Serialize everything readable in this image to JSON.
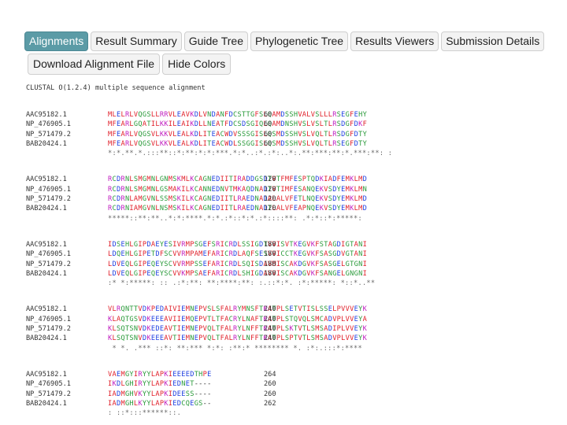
{
  "tabs": [
    "Alignments",
    "Result Summary",
    "Guide Tree",
    "Phylogenetic Tree",
    "Results Viewers",
    "Submission Details"
  ],
  "active_tab": "Alignments",
  "buttons": {
    "download": "Download Alignment File",
    "hide_colors": "Hide Colors"
  },
  "alignment": {
    "header": "CLUSTAL O(1.2.4) multiple sequence alignment",
    "blocks": [
      {
        "rows": [
          {
            "name": "AAC95182.1",
            "seq": "MLELRLVQGSLLRRVLEAVKDLVNDANFDCSTTGFSLQAMDSSHVALVSLLLRSEGFEHY",
            "pos": "60"
          },
          {
            "name": "NP_476905.1",
            "seq": "MFEARLGQATILKKILEAIKDLLNEATFDCSDSGIQLQAMDNSHVSLVSLTLRSDGFDKF",
            "pos": "60"
          },
          {
            "name": "NP_571479.2",
            "seq": "MFEARLVQGSVLKKVLEALKDLITEACWDVSSSGISLQSMDSSHVSLVQLTLRSDGFDTY",
            "pos": "60"
          },
          {
            "name": "BAB20424.1",
            "seq": "MFEARLVQGSVLKKVLEALKDLITEACWDLSSGGISLQSMDSSHVSLVQLTLRSEGFDTY",
            "pos": "60"
          }
        ],
        "consensus": "*:*.**.*.:::**::*:**:*:*:***.*:*..:*.:*:..*:.**:***:**:*.***:**: :"
      },
      {
        "rows": [
          {
            "name": "AAC95182.1",
            "seq": "RCDRNLSMGMNLGNMSKMLKCAGNEDIITIRADDGSDTVTFMFESPTQDKIADFEMKLMD",
            "pos": "120"
          },
          {
            "name": "NP_476905.1",
            "seq": "RCDRNLSMGMNLGSMAKILKCANNEDNVTMKAQDNADTVTIMFESANQEKVSDYEMKLMN",
            "pos": "120"
          },
          {
            "name": "NP_571479.2",
            "seq": "RCDRNLAMGVNLSSMSKILKCAGNEDIITLRAEDNADALALVFETLNQEKVSDYEMKLMD",
            "pos": "120"
          },
          {
            "name": "BAB20424.1",
            "seq": "RCDRNIAMGVNLNSMSKILKCAGNEDIITLRAEDNADTLALVFEAPNQEKVSDYEMKLMD",
            "pos": "120"
          }
        ],
        "consensus": "*****::**:**..*:*:****.*:*.:*::*:*.:*::::**: .*:*::*:*****:"
      },
      {
        "rows": [
          {
            "name": "AAC95182.1",
            "seq": "IDSEHLGIPDAEYESIVRMPSGEFSRICRDLSSIGDTVVISVTKEGVKFSTAGDIGTANI",
            "pos": "180"
          },
          {
            "name": "NP_476905.1",
            "seq": "LDQEHLGIPETDFSCVVRMPAMEFARICRDLAQFSESVVICCTKEGVKFSASGDVGTANI",
            "pos": "180"
          },
          {
            "name": "NP_571479.2",
            "seq": "LDVEQLGIPEQEYSCVVRMPSSEFARICRDLSQISDAVMISCAKDGVKFSASGELGTGNI",
            "pos": "180"
          },
          {
            "name": "BAB20424.1",
            "seq": "LDVEQLGIPEQEYSCVVKMPSAEFARICRDLSHIGDAVVISCAKDGVKFSANGELGNGNI",
            "pos": "180"
          }
        ],
        "consensus": ":* *:*****: :: .:*:**: **:****:**: :.::*:*. :*:*****: *::*..**"
      },
      {
        "rows": [
          {
            "name": "AAC95182.1",
            "seq": "VLRQNTTVDKPEDAIVIEMNEPVSLSFALRYMNSFTKATPLSETVTISLSSELPVVVEYK",
            "pos": "240"
          },
          {
            "name": "NP_476905.1",
            "seq": "KLAQTGSVDKEEEAVIIEMQEPVTLTFACRYLNAFTKATPLSTQVQLSMCADVPLVVEYA",
            "pos": "240"
          },
          {
            "name": "NP_571479.2",
            "seq": "KLSQTSNVDKEDEAVTIEMNEPVQLTFALRYLNFFTKATPLSKTVTLSMSADIPLVVEYK",
            "pos": "240"
          },
          {
            "name": "BAB20424.1",
            "seq": "KLSQTSNVDKEEEAVTIEMNEPVQLTFALRYLNFFTKATPLSPTVTLSMSADVPLVVEYK",
            "pos": "240"
          }
        ],
        "consensus": " * *. .*** ::*: **:*** *:*: :**:* ******** *. :*:.:::*:****"
      },
      {
        "rows": [
          {
            "name": "AAC95182.1",
            "seq": "VAEMGYIRYYLAPKIEEEEDTHPE",
            "pos": "264"
          },
          {
            "name": "NP_476905.1",
            "seq": "IKDLGHIRYYLAPKIEDNET----",
            "pos": "260"
          },
          {
            "name": "NP_571479.2",
            "seq": "IADMGHVKYYLAPKIDEESS----",
            "pos": "260"
          },
          {
            "name": "BAB20424.1",
            "seq": "IADMGHLKYYLAPKIEDCQEGS--",
            "pos": "262"
          }
        ],
        "consensus": ": ::*:::******::."
      }
    ]
  }
}
